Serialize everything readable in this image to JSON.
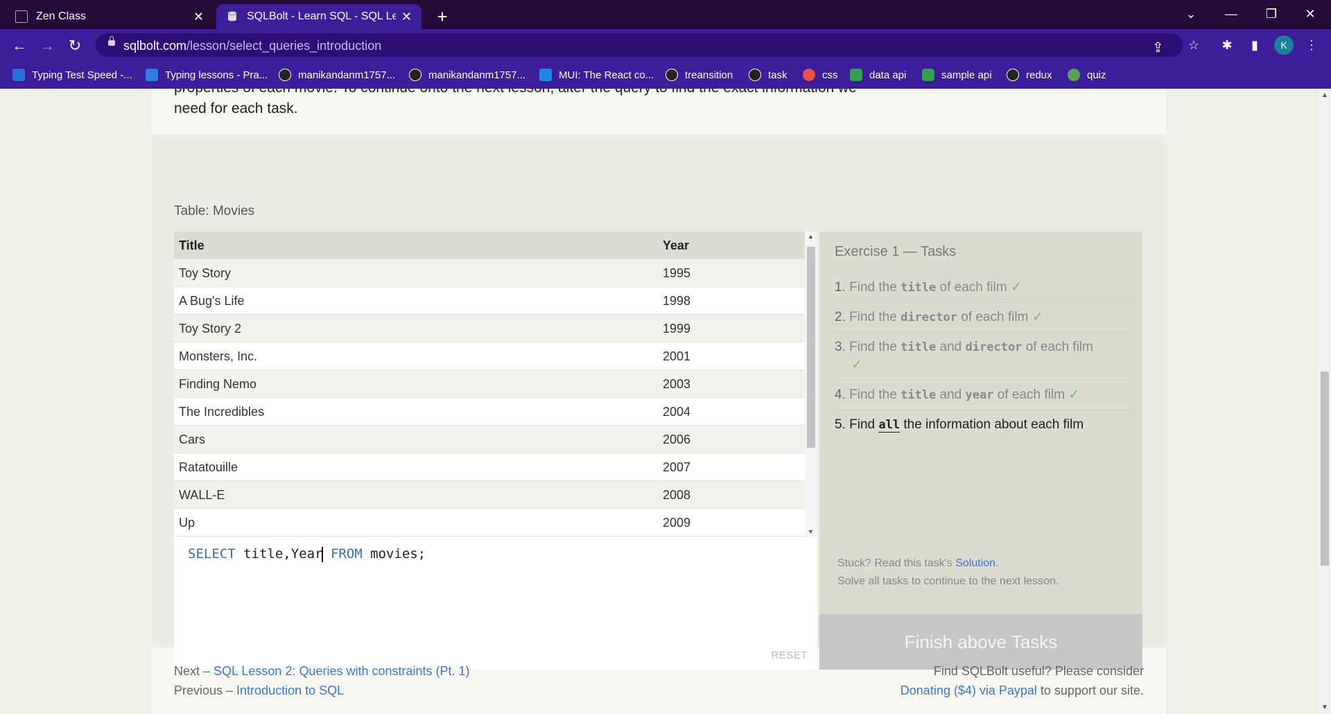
{
  "browser": {
    "tabs": [
      {
        "title": "Zen Class",
        "active": false
      },
      {
        "title": "SQLBolt - Learn SQL - SQL Lesson",
        "active": true
      }
    ],
    "url_host": "sqlbolt.com",
    "url_path": "/lesson/select_queries_introduction",
    "avatar_letter": "K",
    "bookmarks": [
      {
        "label": "Typing Test Speed -...",
        "icon_color": "#2b6fd6"
      },
      {
        "label": "Typing lessons - Pra...",
        "icon_color": "#2f7de0"
      },
      {
        "label": "manikandanm1757...",
        "icon_color": "#222222"
      },
      {
        "label": "manikandanm1757...",
        "icon_color": "#222222"
      },
      {
        "label": "MUI: The React co...",
        "icon_color": "#1e88e5"
      },
      {
        "label": "treansition",
        "icon_color": "#222222"
      },
      {
        "label": "task",
        "icon_color": "#222222"
      },
      {
        "label": "css",
        "icon_color": "#e5534b"
      },
      {
        "label": "data api",
        "icon_color": "#30a14e"
      },
      {
        "label": "sample api",
        "icon_color": "#30a14e"
      },
      {
        "label": "redux",
        "icon_color": "#222222"
      },
      {
        "label": "quiz",
        "icon_color": "#5aa05a"
      }
    ]
  },
  "lesson": {
    "intro_cut": "properties of each movie. To continue onto the next lesson, alter the query to find the exact information we",
    "intro_last": "need for each task.",
    "table_caption": "Table: Movies",
    "table": {
      "headers": [
        "Title",
        "Year"
      ],
      "rows": [
        [
          "Toy Story",
          "1995"
        ],
        [
          "A Bug's Life",
          "1998"
        ],
        [
          "Toy Story 2",
          "1999"
        ],
        [
          "Monsters, Inc.",
          "2001"
        ],
        [
          "Finding Nemo",
          "2003"
        ],
        [
          "The Incredibles",
          "2004"
        ],
        [
          "Cars",
          "2006"
        ],
        [
          "Ratatouille",
          "2007"
        ],
        [
          "WALL-E",
          "2008"
        ],
        [
          "Up",
          "2009"
        ]
      ]
    },
    "query": {
      "kw_select": "SELECT",
      "cols_before_cursor": " title,Year",
      "kw_from": "FROM",
      "tail": " movies;"
    },
    "reset_label": "RESET",
    "exercise": {
      "title": "Exercise 1 — Tasks",
      "tasks": [
        {
          "num": "1.",
          "parts": [
            "Find the ",
            "title",
            " of each film"
          ],
          "done": true
        },
        {
          "num": "2.",
          "parts": [
            "Find the ",
            "director",
            " of each film"
          ],
          "done": true
        },
        {
          "num": "3.",
          "parts": [
            "Find the ",
            "title",
            " and ",
            "director",
            " of each film"
          ],
          "done": true
        },
        {
          "num": "4.",
          "parts": [
            "Find the ",
            "title",
            " and ",
            "year",
            " of each film"
          ],
          "done": true
        },
        {
          "num": "5.",
          "parts": [
            "Find ",
            "all",
            " the information about each film"
          ],
          "done": false
        }
      ],
      "check_mark": "✓",
      "stuck_prefix": "Stuck? Read this task's ",
      "solution_link": "Solution",
      "stuck_suffix": ".",
      "solve_all": "Solve all tasks to continue to the next lesson.",
      "finish_button": "Finish above Tasks"
    },
    "footer": {
      "next_prefix": "Next – ",
      "next_link": "SQL Lesson 2: Queries with constraints (Pt. 1)",
      "prev_prefix": "Previous – ",
      "prev_link": "Introduction to SQL",
      "useful": "Find SQLBolt useful? Please consider",
      "donate_link": "Donating ($4) via Paypal",
      "donate_suffix": " to support our site."
    }
  }
}
